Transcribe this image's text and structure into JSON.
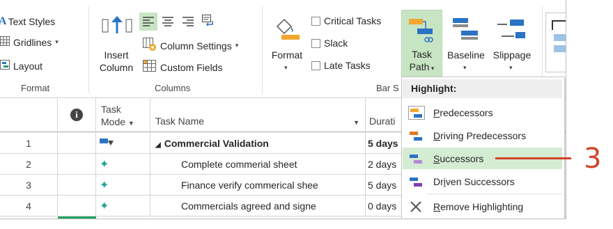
{
  "ribbon": {
    "format_group": {
      "text_styles": "Text Styles",
      "gridlines": "Gridlines",
      "layout": "Layout",
      "label": "Format"
    },
    "columns_group": {
      "insert_column_line1": "Insert",
      "insert_column_line2": "Column",
      "column_settings": "Column Settings",
      "custom_fields": "Custom Fields",
      "label": "Columns"
    },
    "barstyles_group": {
      "format": "Format",
      "critical_tasks": "Critical Tasks",
      "slack": "Slack",
      "late_tasks": "Late Tasks",
      "task_path_line1": "Task",
      "task_path_line2": "Path",
      "baseline": "Baseline",
      "slippage": "Slippage",
      "label": "Bar S"
    },
    "colors": {
      "accent_green": "#21a366",
      "blue": "#2b73c4",
      "orange": "#f0a830"
    }
  },
  "grid": {
    "headers": {
      "info_icon": "info-icon",
      "task_mode_line1": "Task",
      "task_mode_line2": "Mode",
      "task_name": "Task Name",
      "duration": "Durati"
    },
    "rows": [
      {
        "num": "1",
        "name": "Commercial Validation",
        "duration": "5 days",
        "summary": true
      },
      {
        "num": "2",
        "name": "Complete commerial sheet",
        "duration": "2 days",
        "summary": false
      },
      {
        "num": "3",
        "name": "Finance verify commerical shee",
        "duration": "5 days",
        "summary": false
      },
      {
        "num": "4",
        "name": "Commercials agreed and signe",
        "duration": "0 days",
        "summary": false
      }
    ]
  },
  "menu": {
    "header": "Highlight:",
    "items": [
      {
        "pre": "",
        "ul": "P",
        "post": "redecessors"
      },
      {
        "pre": "",
        "ul": "D",
        "post": "riving Predecessors"
      },
      {
        "pre": "",
        "ul": "S",
        "post": "uccessors"
      },
      {
        "pre": "Dr",
        "ul": "i",
        "post": "ven Successors"
      },
      {
        "pre": "",
        "ul": "R",
        "post": "emove Highlighting"
      }
    ]
  },
  "callout": {
    "number": "3",
    "color": "#d1442a"
  }
}
